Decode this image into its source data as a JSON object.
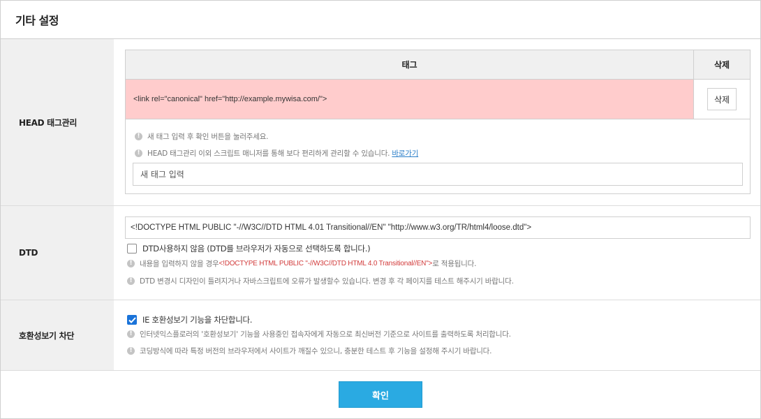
{
  "page": {
    "title": "기타 설정"
  },
  "head_section": {
    "label": "HEAD 태그관리",
    "col_tag": "태그",
    "col_delete": "삭제",
    "rows": [
      {
        "tag": "<link rel=\"canonical\" href=\"http://example.mywisa.com/\">",
        "delete_label": "삭제",
        "highlight": "#ffcccc"
      }
    ],
    "notes": [
      "새 태그 입력 후 확인 버튼을 눌러주세요.",
      "HEAD 태그관리 이외 스크립트 매니저를 통해 보다 편리하게 관리할 수 있습니다."
    ],
    "shortcut_link": "바로가기",
    "new_tag_placeholder": "새 태그 입력"
  },
  "dtd_section": {
    "label": "DTD",
    "value": "<!DOCTYPE HTML PUBLIC \"-//W3C//DTD HTML 4.01 Transitional//EN\" \"http://www.w3.org/TR/html4/loose.dtd\">",
    "checkbox_label": "DTD사용하지 않음 (DTD를 브라우저가 자동으로 선택하도록 합니다.)",
    "checkbox_checked": false,
    "note1_prefix": "내용을 입력하지 않을 경우 ",
    "note1_code": "<!DOCTYPE HTML PUBLIC \"-//W3C//DTD HTML 4.0 Transitional//EN\">",
    "note1_suffix": "로 적용됩니다.",
    "note2": "DTD 변경시 디자인이 틀려지거나 자바스크립트에 오류가 발생할수 있습니다. 변경 후 각 페이지를 테스트 해주시기 바랍니다."
  },
  "compat_section": {
    "label": "호환성보기 차단",
    "checkbox_label": "IE 호환성보기 기능을 차단합니다.",
    "checkbox_checked": true,
    "note1": "인터넷익스플로러의 '호환성보기' 기능을 사용중인 접속자에게 자동으로 최신버전 기준으로 사이트를 출력하도록 처리합니다.",
    "note2": "코딩방식에 따라 특정 버전의 브라우저에서 사이트가 깨질수 있으니, 충분한 테스트 후 기능을 설정해 주시기 바랍니다."
  },
  "footer": {
    "confirm_label": "확인"
  },
  "colors": {
    "accent": "#2aaae2",
    "highlight_row": "#ffcccc",
    "checkbox_on": "#1a73d9",
    "label_bg": "#f0f0f0"
  },
  "icons": {
    "note": "info-circle-icon",
    "check": "checkmark-icon"
  }
}
